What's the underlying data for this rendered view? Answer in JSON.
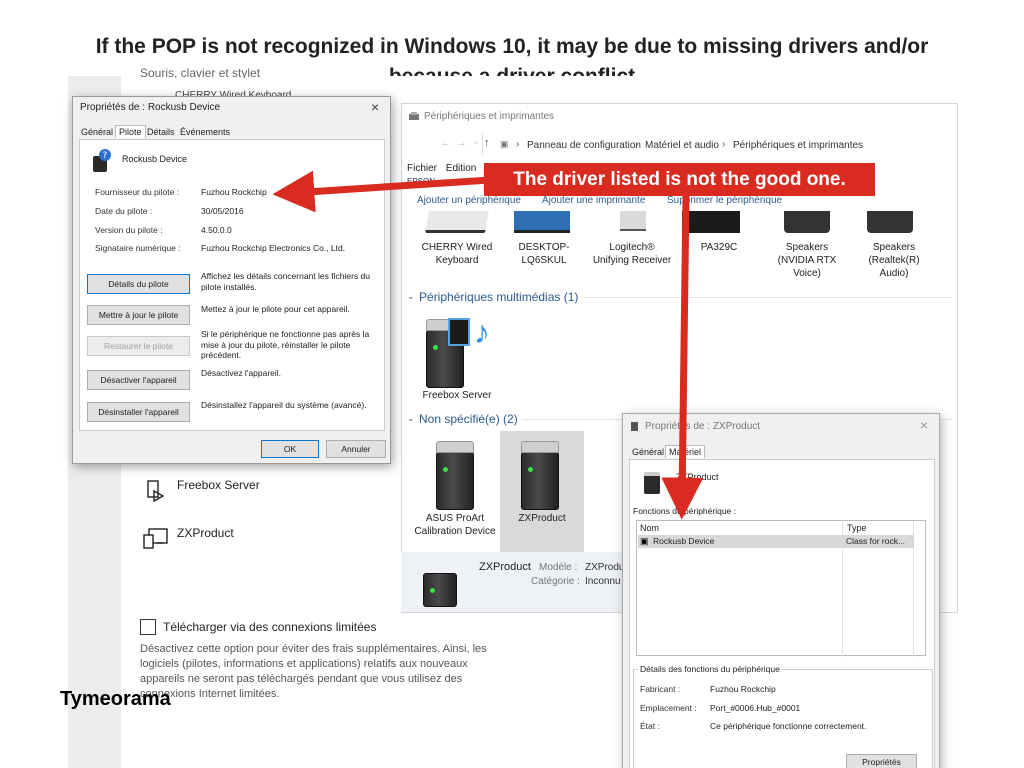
{
  "slide": {
    "title_line1": "If the POP is not recognized in Windows 10, it may be due to missing drivers and/or",
    "title_line2": "because a driver conflict",
    "annotation": "The driver listed is not the good one.",
    "brand": "Tymeorama",
    "accent_color": "#d92b20"
  },
  "settings_page": {
    "cut_top_text": "Souris, clavier et stylet",
    "cut_second_text": "CHERRY Wired Keyboard",
    "devices": [
      {
        "name": "Freebox Server",
        "icon": "media-device-icon"
      },
      {
        "name": "ZXProduct",
        "icon": "unknown-device-icon"
      }
    ],
    "metered_checkbox_label": "Télécharger via des connexions limitées",
    "metered_description": "Désactivez cette option pour éviter des frais supplémentaires. Ainsi, les logiciels (pilotes, informations et applications) relatifs aux nouveaux appareils ne seront pas téléchargés pendant que vous utilisez des connexions Internet limitées."
  },
  "devices_window": {
    "title": "Périphériques et imprimantes",
    "breadcrumb": [
      "Panneau de configuration",
      "Matériel et audio",
      "Périphériques et imprimantes"
    ],
    "menu": [
      "Fichier",
      "Edition"
    ],
    "menu_cut": "EPSON",
    "commands": [
      "Ajouter un périphérique",
      "Ajouter une imprimante",
      "Supprimer le périphérique"
    ],
    "devices_row": [
      {
        "label": "CHERRY Wired Keyboard",
        "icon": "keyboard-icon"
      },
      {
        "label": "DESKTOP-LQ6SKUL",
        "icon": "computer-icon"
      },
      {
        "label": "Logitech® Unifying Receiver",
        "icon": "usb-receiver-icon"
      },
      {
        "label": "PA329C",
        "icon": "monitor-icon"
      },
      {
        "label": "Speakers (NVIDIA RTX Voice)",
        "icon": "speaker-icon"
      },
      {
        "label": "Speakers (Realtek(R) Audio)",
        "icon": "speaker-icon"
      }
    ],
    "section_multimedia": "Périphériques multimédias (1)",
    "multimedia_device": "Freebox Server",
    "section_unspecified": "Non spécifié(e) (2)",
    "unspecified_devices": [
      "ASUS ProArt Calibration Device",
      "ZXProduct"
    ],
    "detail": {
      "name": "ZXProduct",
      "model_label": "Modèle :",
      "model_value": "ZXProdu",
      "category_label": "Catégorie :",
      "category_value": "Inconnu"
    }
  },
  "rockusb_dialog": {
    "title": "Propriétés de : Rockusb Device",
    "tabs": [
      "Général",
      "Pilote",
      "Détails",
      "Événements"
    ],
    "active_tab": "Pilote",
    "device_name": "Rockusb Device",
    "fields": [
      {
        "key": "Fournisseur du pilote :",
        "value": "Fuzhou Rockchip"
      },
      {
        "key": "Date du pilote :",
        "value": "30/05/2016"
      },
      {
        "key": "Version du pilote :",
        "value": "4.50.0.0"
      },
      {
        "key": "Signataire numérique :",
        "value": "Fuzhou Rockchip Electronics Co., Ltd."
      }
    ],
    "actions": [
      {
        "button": "Détails du pilote",
        "description": "Affichez les détails concernant les fichiers du pilote installés."
      },
      {
        "button": "Mettre à jour le pilote",
        "description": "Mettez à jour le pilote pour cet appareil."
      },
      {
        "button": "Restaurer le pilote",
        "description": "Si le périphérique ne fonctionne pas après la mise à jour du pilote, réinstaller le pilote précédent."
      },
      {
        "button": "Désactiver l'appareil",
        "description": "Désactivez l'appareil."
      },
      {
        "button": "Désinstaller l'appareil",
        "description": "Désinstallez l'appareil du système (avancé)."
      }
    ],
    "ok": "OK",
    "cancel": "Annuler"
  },
  "zx_dialog": {
    "title": "Propriétés de : ZXProduct",
    "tabs": [
      "Général",
      "Matériel"
    ],
    "active_tab": "Matériel",
    "device_name": "ZXProduct",
    "functions_label": "Fonctions du périphérique :",
    "columns": [
      "Nom",
      "Type"
    ],
    "rows": [
      {
        "name": "Rockusb Device",
        "type": "Class for rock..."
      }
    ],
    "details_title": "Détails des fonctions du périphérique",
    "details": [
      {
        "key": "Fabricant :",
        "value": "Fuzhou Rockchip"
      },
      {
        "key": "Emplacement :",
        "value": "Port_#0006.Hub_#0001"
      },
      {
        "key": "État :",
        "value": "Ce périphérique fonctionne correctement."
      }
    ],
    "properties_button": "Propriétés"
  }
}
